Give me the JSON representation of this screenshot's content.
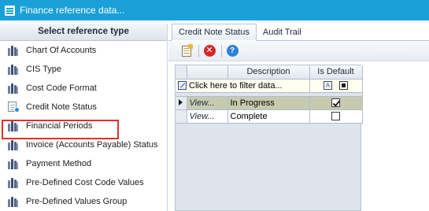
{
  "window": {
    "title": "Finance reference data..."
  },
  "left_panel": {
    "header": "Select reference type",
    "items": [
      {
        "label": "Chart Of Accounts",
        "icon": "books-icon"
      },
      {
        "label": "CIS Type",
        "icon": "books-icon"
      },
      {
        "label": "Cost Code Format",
        "icon": "books-icon"
      },
      {
        "label": "Credit Note Status",
        "icon": "credit-note-icon",
        "selected": true
      },
      {
        "label": "Financial Periods",
        "icon": "books-icon"
      },
      {
        "label": "Invoice (Accounts Payable) Status",
        "icon": "books-icon"
      },
      {
        "label": "Payment Method",
        "icon": "books-icon"
      },
      {
        "label": "Pre-Defined Cost Code Values",
        "icon": "books-icon"
      },
      {
        "label": "Pre-Defined Values Group",
        "icon": "books-icon"
      }
    ],
    "highlight_color": "#e0312a"
  },
  "tabs": [
    {
      "label": "Credit Note Status",
      "active": true
    },
    {
      "label": "Audit Trail",
      "active": false
    }
  ],
  "toolbar": {
    "icons": [
      "new-record-icon",
      "delete-icon",
      "help-icon"
    ],
    "delete_glyph": "✕",
    "help_glyph": "?"
  },
  "grid": {
    "columns": [
      "",
      "Description",
      "Is Default"
    ],
    "filter_row": {
      "placeholder": "Click here to filter data...",
      "default_filter_glyph": "A"
    },
    "rows": [
      {
        "view": "View...",
        "description": "In Progress",
        "is_default": true,
        "selected": true
      },
      {
        "view": "View...",
        "description": "Complete",
        "is_default": false,
        "selected": false
      }
    ]
  },
  "colors": {
    "titlebar": "#1aa0d8",
    "selected_row": "#c6cbb0",
    "grid_background": "#dde4ec"
  }
}
